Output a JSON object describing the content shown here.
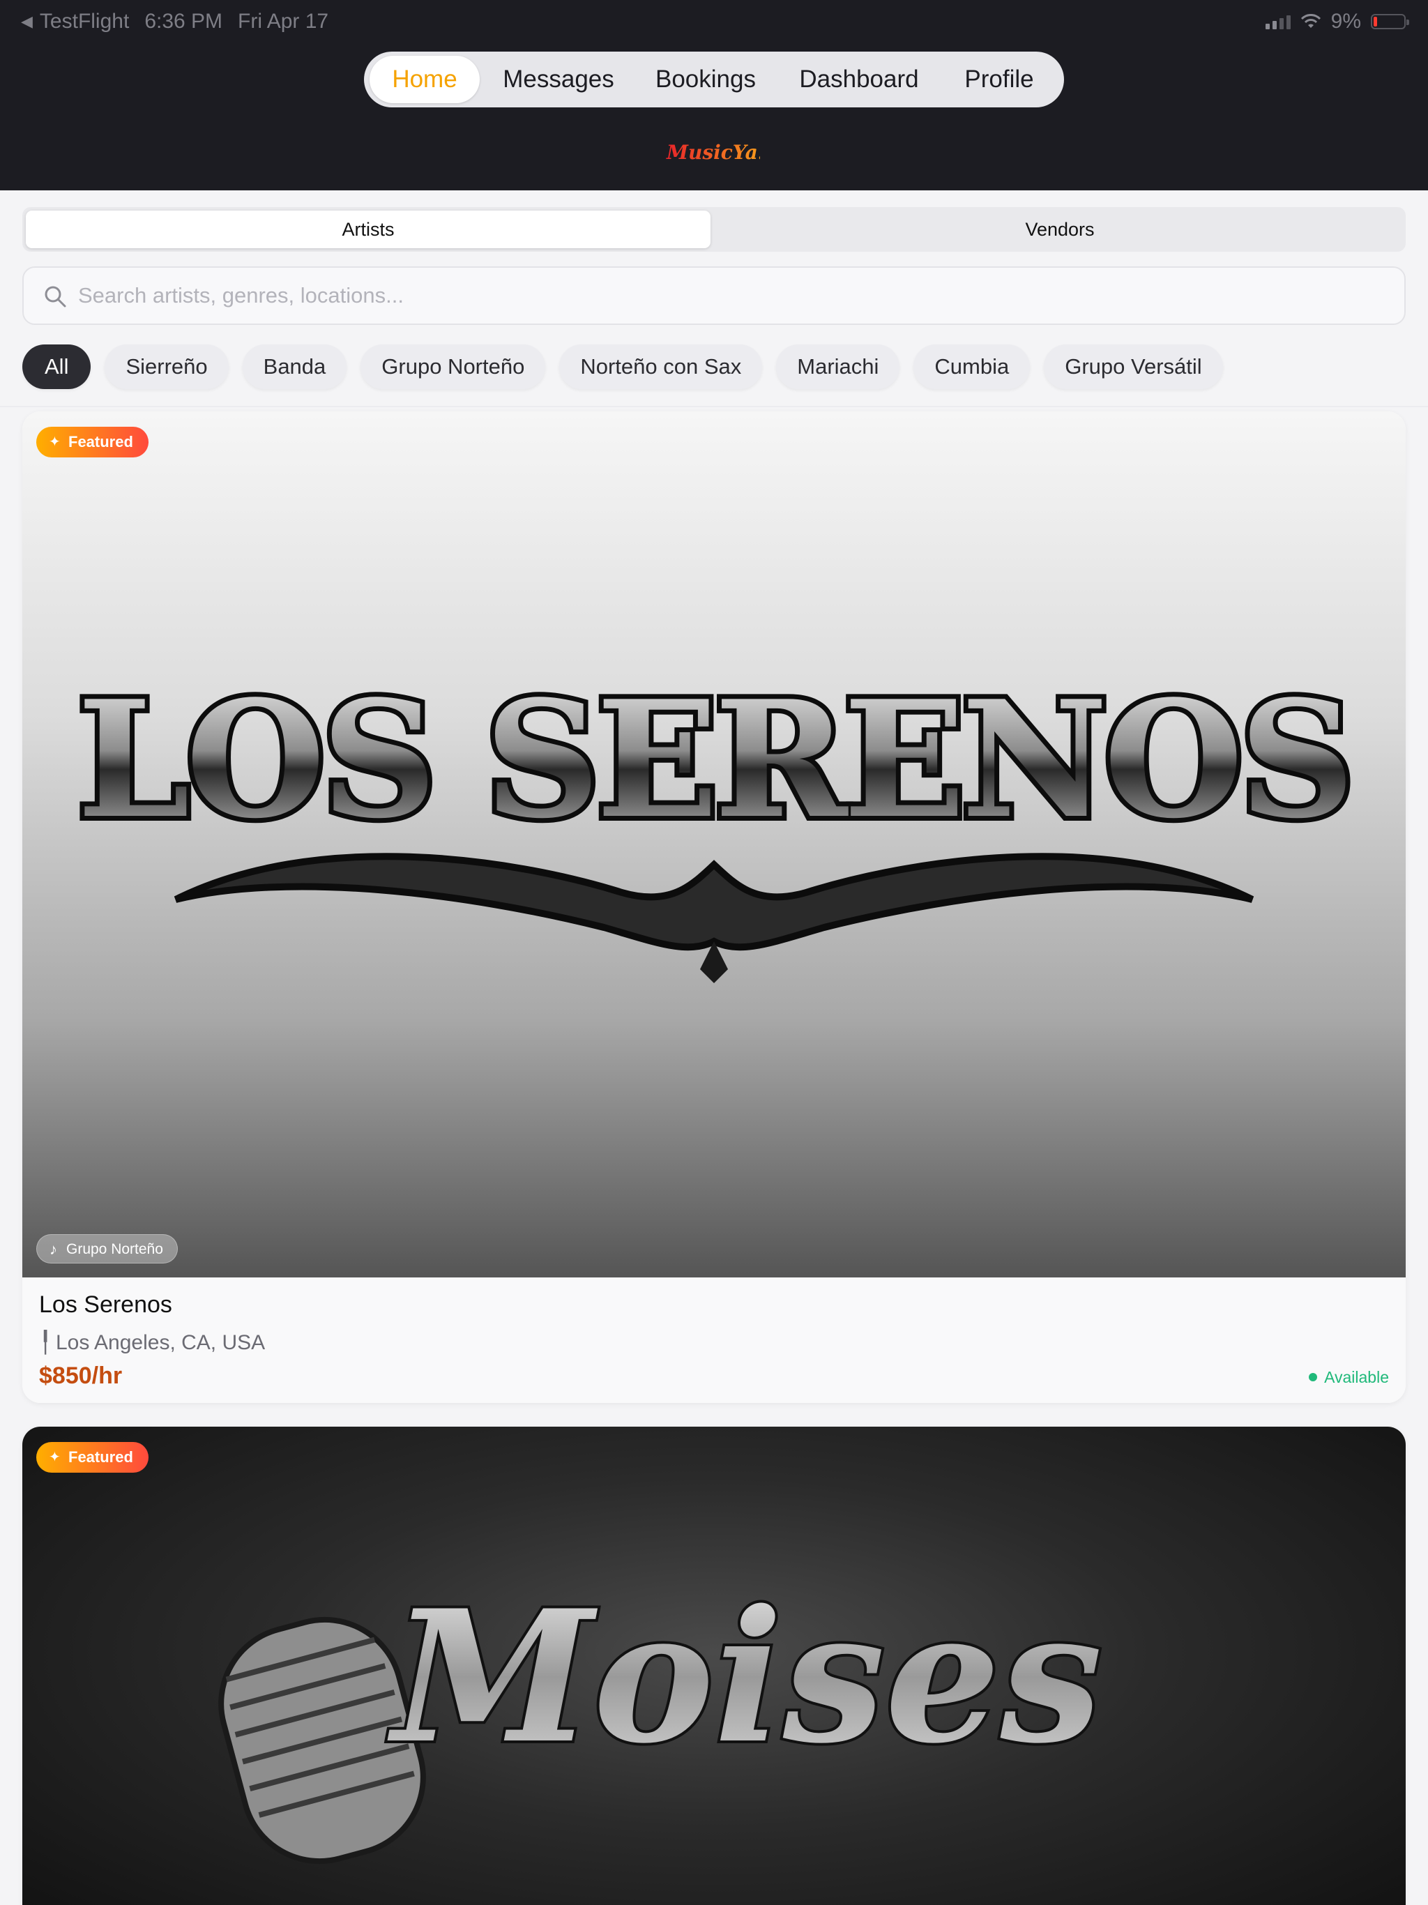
{
  "status_bar": {
    "back_app": "TestFlight",
    "time": "6:36 PM",
    "date": "Fri Apr 17",
    "battery_percent": "9%"
  },
  "nav": {
    "tabs": [
      {
        "label": "Home",
        "active": true
      },
      {
        "label": "Messages",
        "active": false
      },
      {
        "label": "Bookings",
        "active": false
      },
      {
        "label": "Dashboard",
        "active": false
      },
      {
        "label": "Profile",
        "active": false
      }
    ],
    "logo_text": "MusicYa!",
    "accent_color": "#f5a200"
  },
  "segment": {
    "options": [
      "Artists",
      "Vendors"
    ],
    "selected": "Artists"
  },
  "search": {
    "placeholder": "Search artists, genres, locations...",
    "value": ""
  },
  "genre_chips": [
    "All",
    "Sierreño",
    "Banda",
    "Grupo Norteño",
    "Norteño con Sax",
    "Mariachi",
    "Cumbia",
    "Grupo Versátil"
  ],
  "selected_chip": "All",
  "cards": [
    {
      "badge": "Featured",
      "image_logo_text": "LOS SERENOS",
      "genre": "Grupo Norteño",
      "name": "Los Serenos",
      "location": "Los Angeles, CA, USA",
      "price": "$850/hr",
      "availability": "Available"
    },
    {
      "badge": "Featured",
      "image_logo_text": "Moises"
    }
  ]
}
